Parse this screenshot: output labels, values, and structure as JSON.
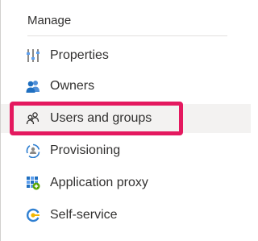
{
  "section": {
    "header": "Manage"
  },
  "nav": {
    "items": [
      {
        "label": "Properties",
        "icon": "properties-icon",
        "selected": false
      },
      {
        "label": "Owners",
        "icon": "owners-icon",
        "selected": false
      },
      {
        "label": "Users and groups",
        "icon": "users-and-groups-icon",
        "selected": true
      },
      {
        "label": "Provisioning",
        "icon": "provisioning-icon",
        "selected": false
      },
      {
        "label": "Application proxy",
        "icon": "application-proxy-icon",
        "selected": false
      },
      {
        "label": "Self-service",
        "icon": "self-service-icon",
        "selected": false
      }
    ]
  },
  "colors": {
    "highlight_border": "#e4195f",
    "selected_background": "#f3f2f1",
    "accent_blue": "#0078d4"
  }
}
